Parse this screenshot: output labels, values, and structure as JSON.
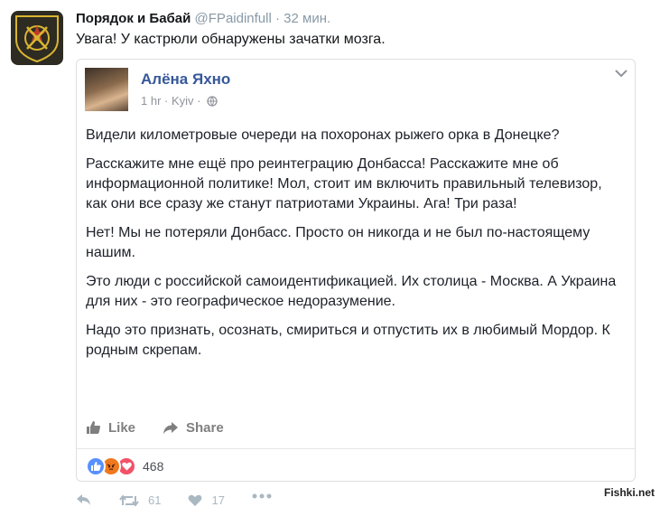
{
  "tweet": {
    "author_name": "Порядок и Бабай",
    "handle": "@FPaidinfull",
    "separator": "·",
    "time": "32 мин.",
    "text": "Увага! У кастрюли обнаружены зачатки мозга.",
    "avatar_icon": "army-emblem-icon"
  },
  "fb_post": {
    "author": "Алёна Яхно",
    "time": "1 hr",
    "location": "Kyiv",
    "separator": "·",
    "paragraphs": [
      "Видели километровые очереди на похоронах рыжего орка в Донецке?",
      "Расскажите мне ещё про реинтеграцию Донбасса! Расскажите мне об информационной политике! Мол, стоит им включить правильный телевизор, как они все сразу же станут патриотами Украины. Ага! Три раза!",
      "Нет! Мы не потеряли Донбасс. Просто он никогда и не был по-настоящему нашим.",
      "Это люди с российской самоидентификацией. Их столица - Москва. А Украина для них - это географическое недоразумение.",
      "Надо это признать, осознать, смириться и отпустить их в любимый Мордор. К родным скрепам."
    ],
    "like_label": "Like",
    "share_label": "Share",
    "reaction_count": "468",
    "colors": {
      "link": "#365899",
      "like": "#5890ff",
      "angry": "#f0781e",
      "love": "#f25268"
    }
  },
  "tweet_actions": {
    "retweet_count": "61",
    "like_count": "17"
  },
  "watermark": "Fishki.net"
}
